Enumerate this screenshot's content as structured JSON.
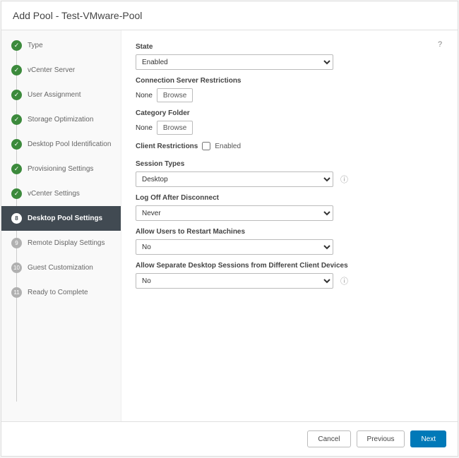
{
  "header": {
    "title": "Add Pool - Test-VMware-Pool"
  },
  "wizard": {
    "steps": [
      {
        "label": "Type",
        "state": "complete"
      },
      {
        "label": "vCenter Server",
        "state": "complete"
      },
      {
        "label": "User Assignment",
        "state": "complete"
      },
      {
        "label": "Storage Optimization",
        "state": "complete"
      },
      {
        "label": "Desktop Pool Identification",
        "state": "complete"
      },
      {
        "label": "Provisioning Settings",
        "state": "complete"
      },
      {
        "label": "vCenter Settings",
        "state": "complete"
      },
      {
        "label": "Desktop Pool Settings",
        "state": "current",
        "num": "8"
      },
      {
        "label": "Remote Display Settings",
        "state": "pending",
        "num": "9"
      },
      {
        "label": "Guest Customization",
        "state": "pending",
        "num": "10"
      },
      {
        "label": "Ready to Complete",
        "state": "pending",
        "num": "11"
      }
    ]
  },
  "form": {
    "state_label": "State",
    "state_value": "Enabled",
    "csr_label": "Connection Server Restrictions",
    "csr_value": "None",
    "browse": "Browse",
    "cat_label": "Category Folder",
    "cat_value": "None",
    "client_restrictions_label": "Client Restrictions",
    "client_enabled_label": "Enabled",
    "session_types_label": "Session Types",
    "session_types_value": "Desktop",
    "logoff_label": "Log Off After Disconnect",
    "logoff_value": "Never",
    "allow_restart_label": "Allow Users to Restart Machines",
    "allow_restart_value": "No",
    "allow_separate_label": "Allow Separate Desktop Sessions from Different Client Devices",
    "allow_separate_value": "No"
  },
  "footer": {
    "cancel": "Cancel",
    "previous": "Previous",
    "next": "Next"
  },
  "icons": {
    "check": "✓",
    "help": "?",
    "info": "ⓘ"
  }
}
